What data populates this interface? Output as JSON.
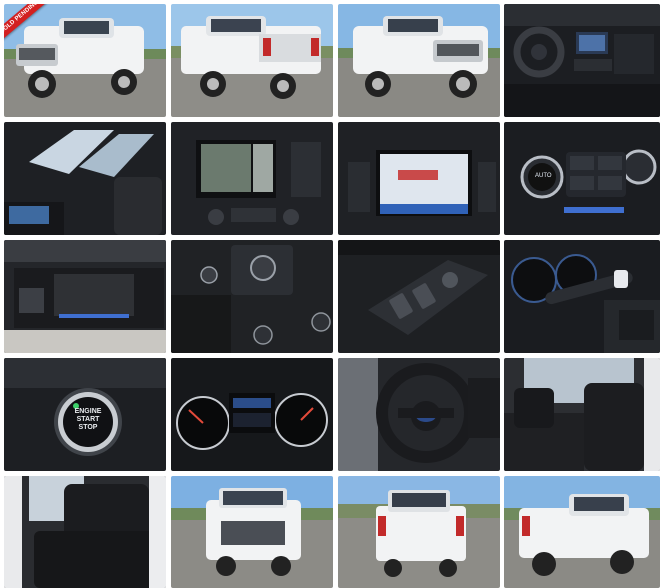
{
  "gallery": {
    "badge_label": "SOLD PENDING",
    "colors": {
      "truck_white": "#f2f3f4",
      "interior_dark": "#1c1e22",
      "sky_blue": "#7fb2e0",
      "lot_gray": "#8a8a86",
      "ambient_blue": "#3f6fd0"
    },
    "engine_button": {
      "line1": "ENGINE",
      "line2": "START",
      "line3": "STOP"
    },
    "climate_readout": "AUTO",
    "photos": [
      {
        "id": "front-quarter"
      },
      {
        "id": "rear-quarter"
      },
      {
        "id": "front-quarter-2"
      },
      {
        "id": "dashboard"
      },
      {
        "id": "sunroof"
      },
      {
        "id": "camera-screen"
      },
      {
        "id": "nav-screen"
      },
      {
        "id": "climate-controls"
      },
      {
        "id": "console-pad"
      },
      {
        "id": "headlight-switch"
      },
      {
        "id": "door-controls"
      },
      {
        "id": "gauge-stalk"
      },
      {
        "id": "start-button"
      },
      {
        "id": "gauge-cluster"
      },
      {
        "id": "steering-wheel"
      },
      {
        "id": "front-seats"
      },
      {
        "id": "rear-seats"
      },
      {
        "id": "front-view"
      },
      {
        "id": "rear-view"
      },
      {
        "id": "rear-quarter-2"
      }
    ]
  }
}
